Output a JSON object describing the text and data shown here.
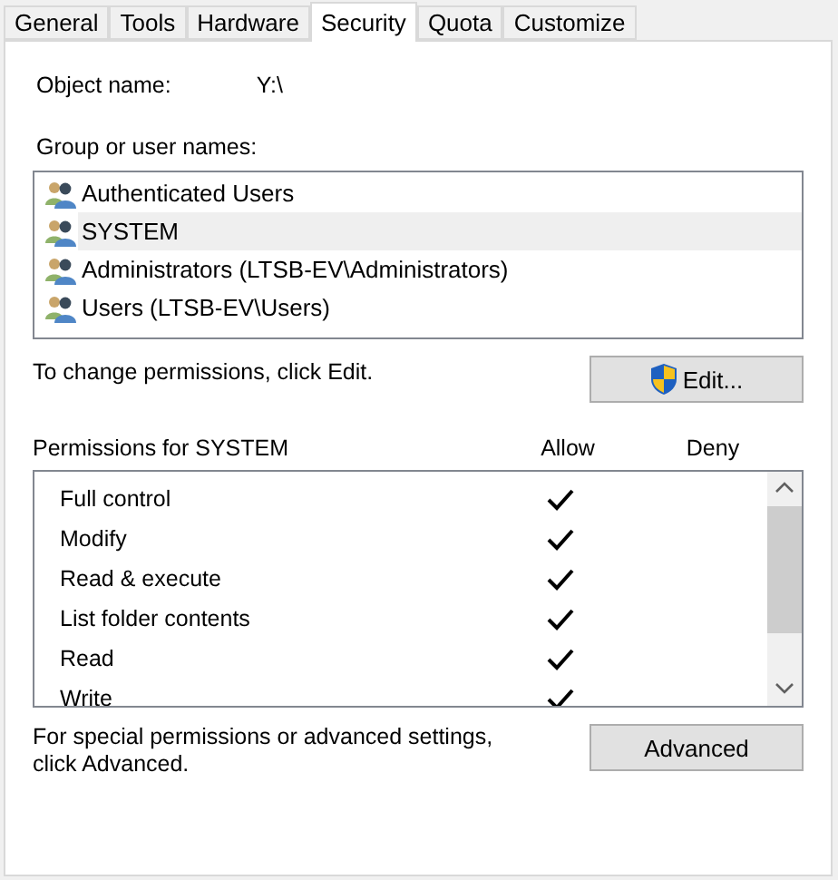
{
  "tabs": [
    {
      "label": "General",
      "selected": false
    },
    {
      "label": "Tools",
      "selected": false
    },
    {
      "label": "Hardware",
      "selected": false
    },
    {
      "label": "Security",
      "selected": true
    },
    {
      "label": "Quota",
      "selected": false
    },
    {
      "label": "Customize",
      "selected": false
    }
  ],
  "object_name": {
    "label": "Object name:",
    "value": "Y:\\"
  },
  "groups": {
    "label": "Group or user names:",
    "items": [
      {
        "name": "Authenticated Users",
        "selected": false
      },
      {
        "name": "SYSTEM",
        "selected": true
      },
      {
        "name": "Administrators (LTSB-EV\\Administrators)",
        "selected": false
      },
      {
        "name": "Users (LTSB-EV\\Users)",
        "selected": false
      }
    ]
  },
  "edit_hint": "To change permissions, click Edit.",
  "edit_button": "Edit...",
  "permissions": {
    "label": "Permissions for SYSTEM",
    "columns": [
      "Allow",
      "Deny"
    ],
    "rows": [
      {
        "name": "Full control",
        "allow": true,
        "deny": false
      },
      {
        "name": "Modify",
        "allow": true,
        "deny": false
      },
      {
        "name": "Read & execute",
        "allow": true,
        "deny": false
      },
      {
        "name": "List folder contents",
        "allow": true,
        "deny": false
      },
      {
        "name": "Read",
        "allow": true,
        "deny": false
      },
      {
        "name": "Write",
        "allow": true,
        "deny": false
      }
    ]
  },
  "advanced_hint": "For special permissions or advanced settings, click Advanced.",
  "advanced_button": "Advanced"
}
